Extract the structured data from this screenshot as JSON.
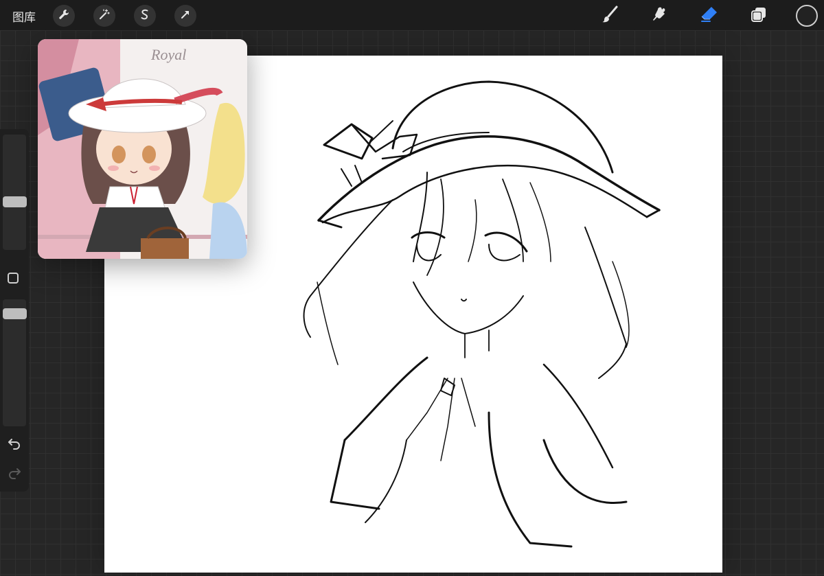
{
  "toolbar": {
    "gallery_label": "图库",
    "left_tools": [
      "wrench-icon",
      "magic-wand-icon",
      "selection-icon",
      "transform-icon"
    ],
    "right_tools": [
      "brush-icon",
      "smudge-icon",
      "eraser-icon",
      "layers-icon",
      "color-icon"
    ],
    "active_tool": "eraser",
    "accent_color": "#2f7ff5"
  },
  "sidebar": {
    "items": [
      "brush-size-slider",
      "modifier-button",
      "brush-opacity-slider",
      "undo-icon",
      "redo-icon"
    ]
  },
  "reference": {
    "visible_text": "Royal"
  }
}
